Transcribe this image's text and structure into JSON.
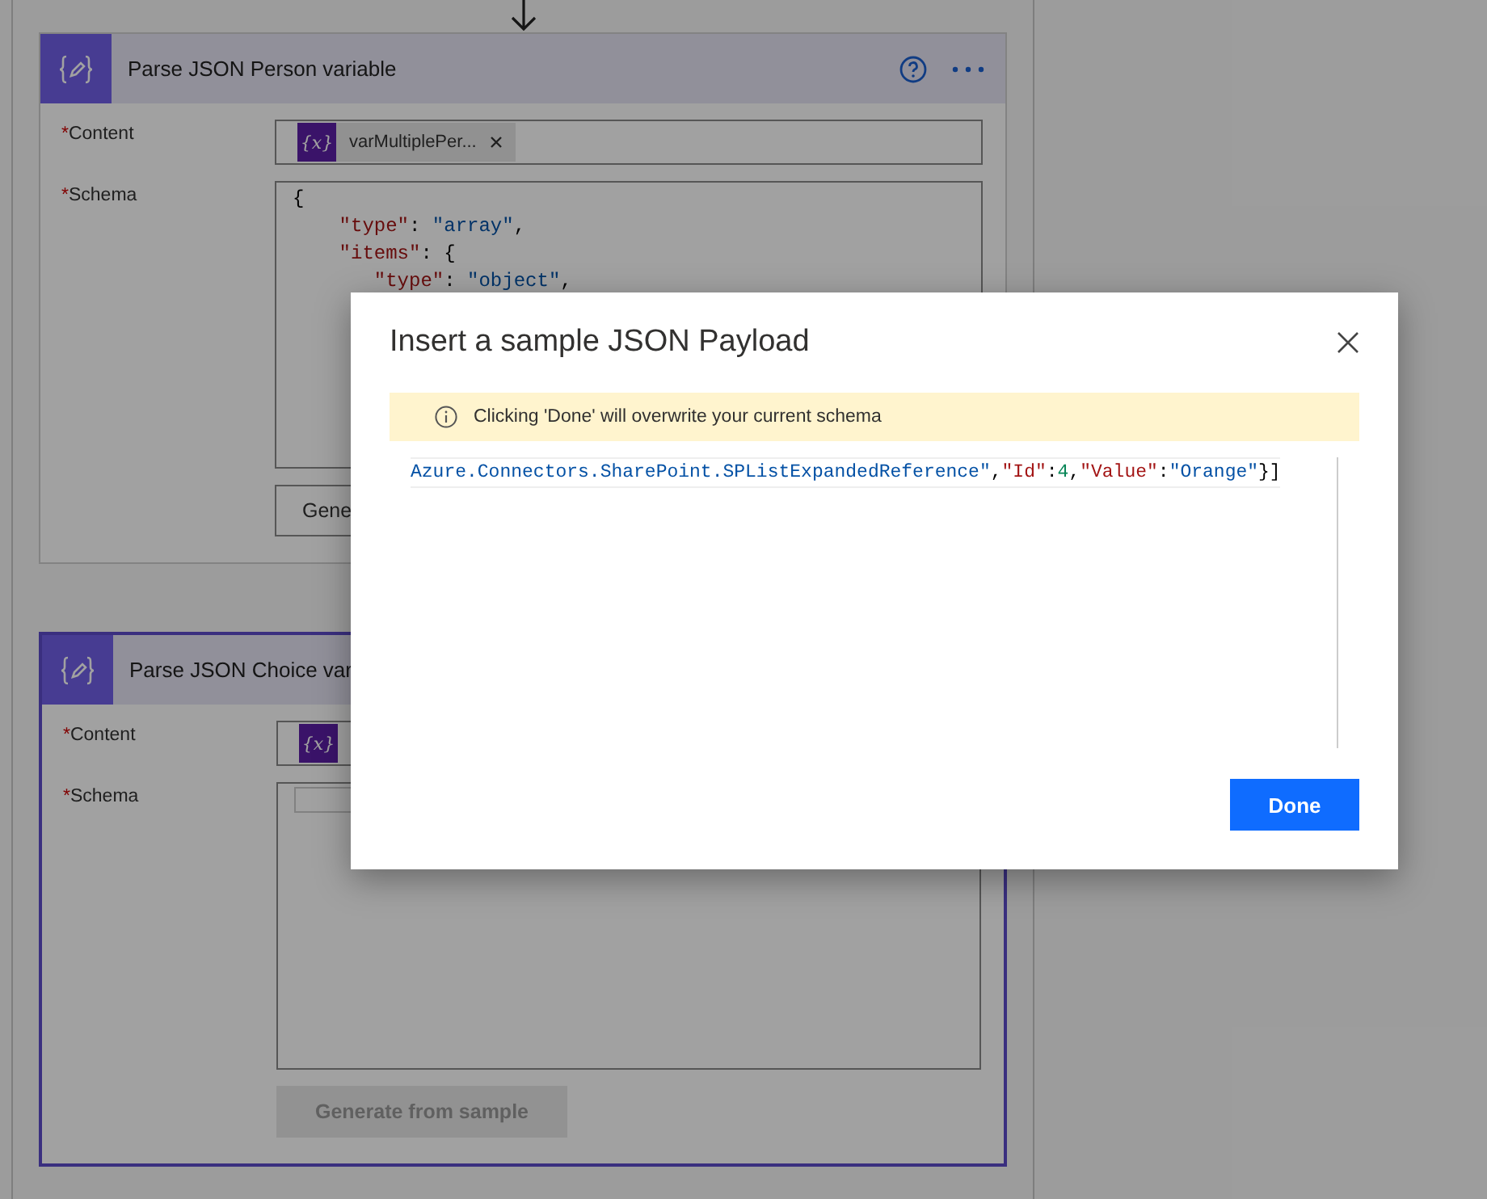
{
  "cards": [
    {
      "title": "Parse JSON Person variable",
      "selected": false,
      "show_actions": true,
      "content_token": {
        "icon_text": "{x}",
        "label": "varMultiplePer...",
        "removable": true
      },
      "schema_lines": [
        [
          {
            "kind": "punct",
            "text": "{"
          }
        ],
        [
          {
            "kind": "key",
            "text": "    \"type\""
          },
          {
            "kind": "punct",
            "text": ": "
          },
          {
            "kind": "string",
            "text": "\"array\""
          },
          {
            "kind": "punct",
            "text": ","
          }
        ],
        [
          {
            "kind": "key",
            "text": "    \"items\""
          },
          {
            "kind": "punct",
            "text": ": {"
          }
        ],
        [
          {
            "kind": "key",
            "text": "       \"type\""
          },
          {
            "kind": "punct",
            "text": ": "
          },
          {
            "kind": "string",
            "text": "\"object\""
          },
          {
            "kind": "punct",
            "text": ","
          }
        ]
      ],
      "fields": [
        {
          "required_mark": "*",
          "label": "Content"
        },
        {
          "required_mark": "*",
          "label": "Schema"
        }
      ],
      "button": {
        "label": "Gene",
        "disabled": false
      }
    },
    {
      "title": "Parse JSON Choice var",
      "selected": true,
      "show_actions": false,
      "content_token": {
        "icon_text": "{x}",
        "removable": false
      },
      "fields": [
        {
          "required_mark": "*",
          "label": "Content"
        },
        {
          "required_mark": "*",
          "label": "Schema"
        }
      ],
      "button": {
        "label": "Generate from sample",
        "disabled": true
      }
    }
  ],
  "dialog": {
    "title": "Insert a sample JSON Payload",
    "notice": "Clicking 'Done' will overwrite your current schema",
    "editor_line": [
      {
        "kind": "string",
        "text": "Azure.Connectors.SharePoint.SPListExpandedReference\""
      },
      {
        "kind": "punct",
        "text": ","
      },
      {
        "kind": "key",
        "text": "\"Id\""
      },
      {
        "kind": "punct",
        "text": ":"
      },
      {
        "kind": "number",
        "text": "4"
      },
      {
        "kind": "punct",
        "text": ","
      },
      {
        "kind": "key",
        "text": "\"Value\""
      },
      {
        "kind": "punct",
        "text": ":"
      },
      {
        "kind": "string",
        "text": "\"Orange\""
      },
      {
        "kind": "punct",
        "text": "}]"
      }
    ],
    "done_button": "Done"
  }
}
